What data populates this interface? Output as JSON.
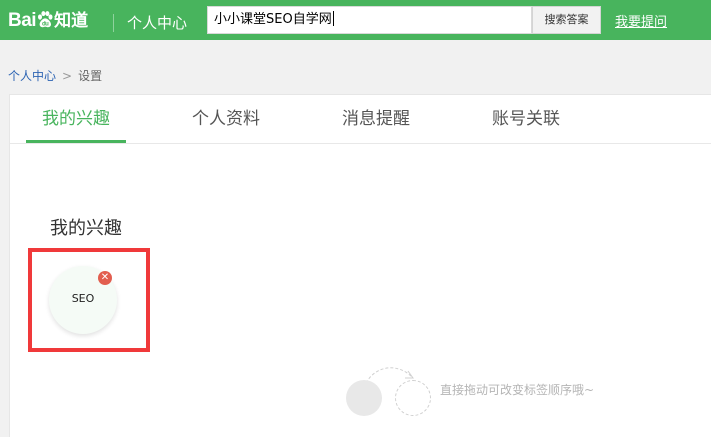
{
  "header": {
    "logo": {
      "bai": "Bai",
      "du": "du",
      "zhidao": "知道"
    },
    "center_title": "个人中心",
    "search": {
      "value": "小小课堂SEO自学网",
      "button_label": "搜索答案"
    },
    "ask_link": "我要提问",
    "colors": {
      "brand": "#48b45d"
    }
  },
  "breadcrumb": {
    "parent": "个人中心",
    "separator": ">",
    "current": "设置"
  },
  "tabs": [
    {
      "label": "我的兴趣",
      "active": true
    },
    {
      "label": "个人资料",
      "active": false
    },
    {
      "label": "消息提醒",
      "active": false
    },
    {
      "label": "账号关联",
      "active": false
    }
  ],
  "interests": {
    "title": "我的兴趣",
    "tags": [
      {
        "label": "SEO",
        "remove_icon": "close-icon"
      }
    ],
    "drag_hint": "直接拖动可改变标签顺序哦~"
  }
}
